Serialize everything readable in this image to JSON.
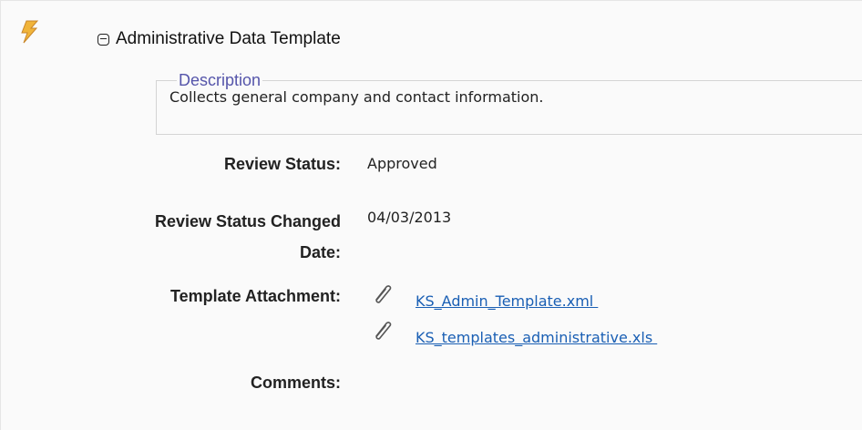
{
  "template": {
    "title": "Administrative Data Template"
  },
  "description": {
    "legend": "Description",
    "text": "Collects general company and contact information."
  },
  "fields": {
    "review_status_label": "Review Status:",
    "review_status_value": "Approved",
    "review_status_changed_label_line1": "Review Status Changed",
    "review_status_changed_label_line2": "Date:",
    "review_status_changed_value": "04/03/2013",
    "template_attachment_label": "Template Attachment:",
    "comments_label": "Comments:"
  },
  "attachments": [
    {
      "name": "KS_Admin_Template.xml "
    },
    {
      "name": "KS_templates_administrative.xls "
    }
  ],
  "colors": {
    "bolt": "#f0b43a",
    "link": "#1a5fb4",
    "legend": "#5555aa"
  },
  "icons": {
    "header": "lightning-bolt-icon",
    "collapse": "collapse-minus-icon",
    "attachment": "paperclip-icon"
  }
}
